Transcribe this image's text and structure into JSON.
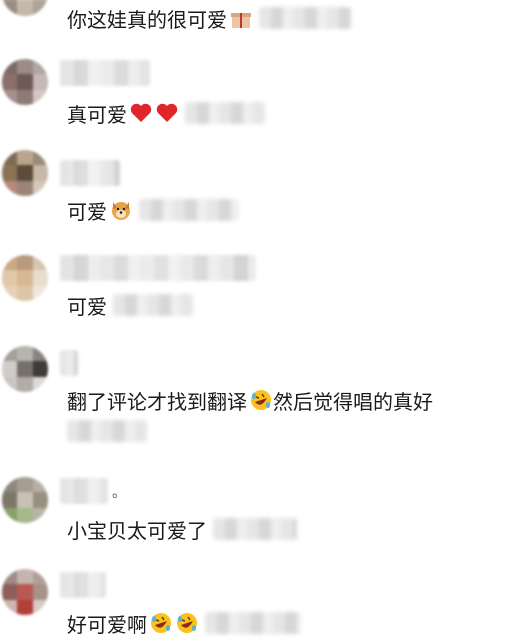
{
  "comments": [
    {
      "text": "你这娃真的很可爱",
      "emojis": [
        "gift-icon"
      ]
    },
    {
      "text": "真可爱",
      "emojis": [
        "red-heart-icon",
        "red-heart-icon"
      ]
    },
    {
      "text": "可爱",
      "emojis": [
        "dog-face-icon"
      ]
    },
    {
      "text": "可爱",
      "emojis": []
    },
    {
      "text": "翻了评论才找到翻译",
      "text_after": "然后觉得唱的真好",
      "emojis": [
        "rolling-laugh-icon"
      ]
    },
    {
      "text": "小宝贝太可爱了",
      "name_suffix": "。",
      "emojis": []
    },
    {
      "text": "好可爱啊",
      "emojis": [
        "rolling-laugh-icon",
        "rolling-laugh-icon"
      ]
    }
  ]
}
